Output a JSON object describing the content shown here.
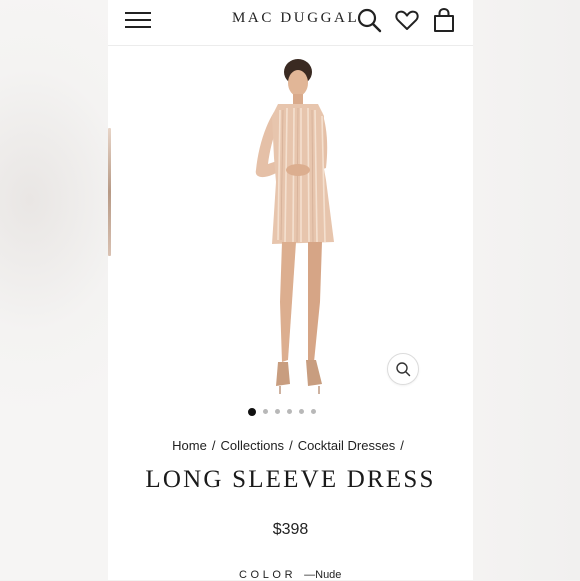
{
  "brand": {
    "logo_text": "MAC DUGGAL"
  },
  "header": {
    "icons": [
      "menu-icon",
      "search-icon",
      "heart-icon",
      "bag-icon"
    ]
  },
  "gallery": {
    "image_alt": "Model wearing nude sequin long sleeve mini dress",
    "dot_count": 6,
    "active_index": 0,
    "zoom_icon": "zoom-search-icon"
  },
  "breadcrumb": {
    "items": [
      "Home",
      "Collections",
      "Cocktail Dresses"
    ],
    "separator": "/"
  },
  "product": {
    "title": "LONG SLEEVE DRESS",
    "price": "$398",
    "color_label": "COLOR",
    "color_value": "—Nude"
  },
  "colors": {
    "dress": "#e7c5ad",
    "sequin_highlight": "#f6e3d3",
    "skin": "#dcae8f",
    "hair": "#3a2a22",
    "text": "#1a1a1a",
    "dot_inactive": "#b8b8b8",
    "dot_active": "#111111"
  }
}
